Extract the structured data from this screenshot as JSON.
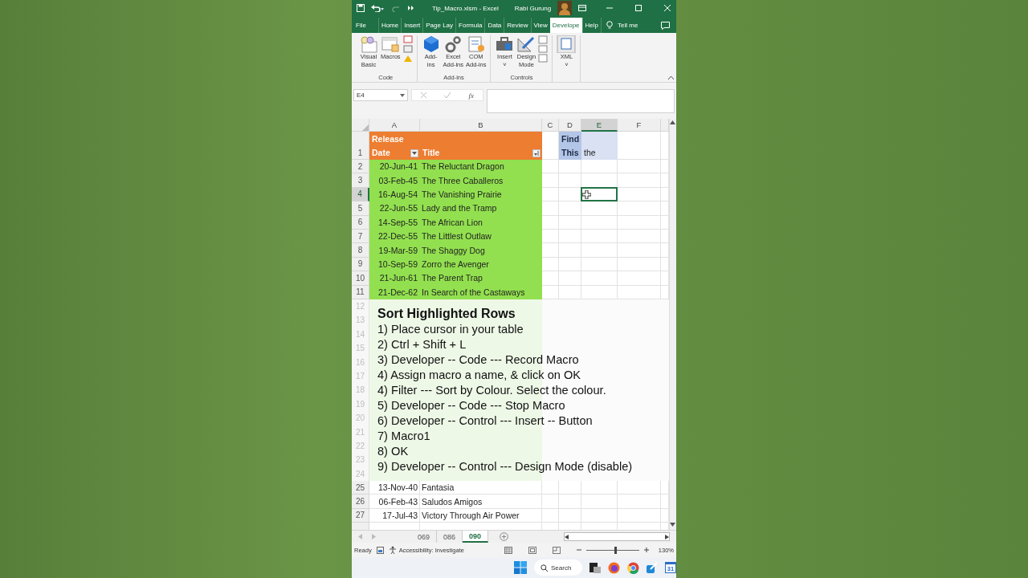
{
  "title_bar": {
    "file_title": "Tip_Macro.xlsm  -  Excel",
    "user_name": "Rabi Gurung"
  },
  "ribbon_tabs": [
    {
      "label": "File",
      "selected": false
    },
    {
      "label": "Home",
      "selected": false
    },
    {
      "label": "Insert",
      "selected": false
    },
    {
      "label": "Page Lay",
      "selected": false
    },
    {
      "label": "Formula",
      "selected": false
    },
    {
      "label": "Data",
      "selected": false
    },
    {
      "label": "Review",
      "selected": false
    },
    {
      "label": "View",
      "selected": false
    },
    {
      "label": "Develope",
      "selected": true
    },
    {
      "label": "Help",
      "selected": false
    }
  ],
  "tell_me": "Tell me",
  "ribbon_groups": [
    {
      "label": "Code",
      "commands": [
        {
          "label": "Visual\nBasic",
          "kind": "vb"
        },
        {
          "label": "Macros",
          "kind": "macros"
        },
        {
          "kind": "small-stack"
        }
      ]
    },
    {
      "label": "Add-ins",
      "commands": [
        {
          "label": "Add-\nins",
          "kind": "addins"
        },
        {
          "label": "Excel\nAdd-ins",
          "kind": "gears"
        },
        {
          "label": "COM\nAdd-ins",
          "kind": "com"
        }
      ]
    },
    {
      "label": "Controls",
      "commands": [
        {
          "label": "Insert\n˅",
          "kind": "toolbox"
        },
        {
          "label": "Design\nMode",
          "kind": "design"
        },
        {
          "kind": "small-stack-2"
        }
      ]
    },
    {
      "commands": [
        {
          "label": "XML\n˅",
          "kind": "xml"
        }
      ]
    }
  ],
  "formula_bar": {
    "name_box": "E4",
    "fx": "fx"
  },
  "columns": [
    {
      "label": "A",
      "selected": false
    },
    {
      "label": "B",
      "selected": false
    },
    {
      "label": "C",
      "selected": false
    },
    {
      "label": "D",
      "selected": false
    },
    {
      "label": "E",
      "selected": true
    },
    {
      "label": "F",
      "selected": false
    }
  ],
  "header_row": {
    "number": "1",
    "date_label": "Release\nDate",
    "title_label": "Title",
    "find_label": "Find\nThis",
    "find_value": "the"
  },
  "rows": [
    {
      "number": "2",
      "date": "20-Jun-41",
      "title": "The Reluctant Dragon",
      "highlighted": true,
      "selected": false
    },
    {
      "number": "3",
      "date": "03-Feb-45",
      "title": "The Three Caballeros",
      "highlighted": true,
      "selected": false
    },
    {
      "number": "4",
      "date": "16-Aug-54",
      "title": "The Vanishing Prairie",
      "highlighted": true,
      "selected": true
    },
    {
      "number": "5",
      "date": "22-Jun-55",
      "title": "Lady and the Tramp",
      "highlighted": true,
      "selected": false
    },
    {
      "number": "6",
      "date": "14-Sep-55",
      "title": "The African Lion",
      "highlighted": true,
      "selected": false
    },
    {
      "number": "7",
      "date": "22-Dec-55",
      "title": "The Littlest Outlaw",
      "highlighted": true,
      "selected": false
    },
    {
      "number": "8",
      "date": "19-Mar-59",
      "title": "The Shaggy Dog",
      "highlighted": true,
      "selected": false
    },
    {
      "number": "9",
      "date": "10-Sep-59",
      "title": "Zorro the Avenger",
      "highlighted": true,
      "selected": false
    },
    {
      "number": "10",
      "date": "21-Jun-61",
      "title": "The Parent Trap",
      "highlighted": true,
      "selected": false
    },
    {
      "number": "11",
      "date": "21-Dec-62",
      "title": "In Search of the Castaways",
      "highlighted": true,
      "selected": false
    }
  ],
  "covered_row_numbers": [
    "12",
    "13",
    "14",
    "15",
    "16",
    "17",
    "18",
    "19",
    "20",
    "21",
    "22",
    "23",
    "24"
  ],
  "note": {
    "title": "Sort Highlighted Rows",
    "steps": [
      "1) Place cursor in your table",
      "2) Ctrl + Shift + L",
      "3) Developer -- Code --- Record Macro",
      "4) Assign macro a name, & click on OK",
      "4) Filter --- Sort by Colour. Select the colour.",
      "5) Developer -- Code --- Stop Macro",
      "6) Developer -- Control --- Insert -- Button",
      "7) Macro1",
      "8) OK",
      "9) Developer -- Control --- Design Mode (disable)"
    ]
  },
  "lower_rows": [
    {
      "number": "25",
      "date": "13-Nov-40",
      "title": "Fantasia",
      "highlighted": false,
      "selected": false
    },
    {
      "number": "26",
      "date": "06-Feb-43",
      "title": "Saludos Amigos",
      "highlighted": false,
      "selected": false
    },
    {
      "number": "27",
      "date": "17-Jul-43",
      "title": "Victory Through Air Power",
      "highlighted": false,
      "selected": false
    }
  ],
  "sheet_tabs": [
    {
      "label": "069",
      "selected": false
    },
    {
      "label": "086",
      "selected": false
    },
    {
      "label": "090",
      "selected": true
    }
  ],
  "status_bar": {
    "mode": "Ready",
    "accessibility": "Accessibility: Investigate",
    "zoom": "130%",
    "zoom_slider": {
      "level": 0.55
    }
  },
  "taskbar": {
    "search": "Search",
    "calendar_day": "31"
  }
}
